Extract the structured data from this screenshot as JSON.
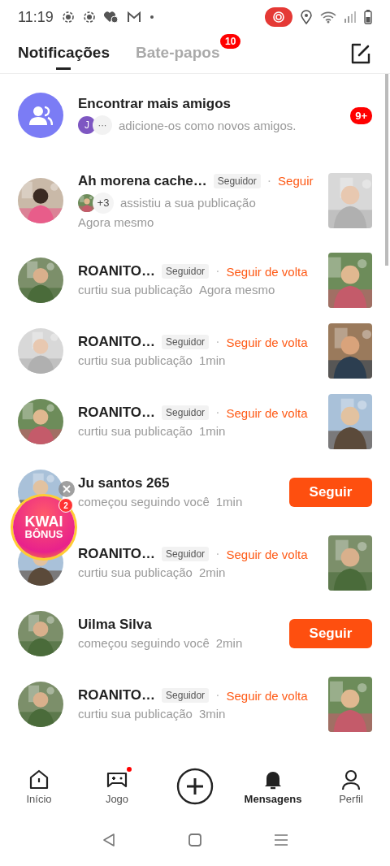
{
  "status_bar": {
    "time": "11:19"
  },
  "tabs": [
    {
      "label": "Notificações",
      "selected": true
    },
    {
      "label": "Bate-papos",
      "selected": false,
      "badge": "10"
    }
  ],
  "find_friends": {
    "title": "Encontrar mais amigos",
    "initial": "J",
    "more": "···",
    "text": "adicione-os como novos amigos.",
    "badge": "9+"
  },
  "notifications": [
    {
      "kind": "activity",
      "name": "Ah morena cache…",
      "tag": "Seguidor",
      "separator": "·",
      "action": "Seguir",
      "extra": "+3",
      "text": "assistiu a sua publicação",
      "time": "Agora mesmo"
    },
    {
      "kind": "activity",
      "name": "ROANITO…",
      "tag": "Seguidor",
      "separator": "·",
      "action": "Seguir de volta",
      "text": "curtiu sua publicação",
      "time": "Agora mesmo"
    },
    {
      "kind": "activity",
      "name": "ROANITO…",
      "tag": "Seguidor",
      "separator": "·",
      "action": "Seguir de volta",
      "text": "curtiu sua publicação",
      "time": "1min"
    },
    {
      "kind": "activity",
      "name": "ROANITO…",
      "tag": "Seguidor",
      "separator": "·",
      "action": "Seguir de volta",
      "text": "curtiu sua publicação",
      "time": "1min"
    },
    {
      "kind": "follow",
      "name": "Ju santos 265",
      "text": "começou seguindo você",
      "time": "1min",
      "button": "Seguir"
    },
    {
      "kind": "activity",
      "name": "ROANITO…",
      "tag": "Seguidor",
      "separator": "·",
      "action": "Seguir de volta",
      "text": "curtiu sua publicação",
      "time": "2min"
    },
    {
      "kind": "follow",
      "name": "Uilma Silva",
      "text": "começou seguindo você",
      "time": "2min",
      "button": "Seguir"
    },
    {
      "kind": "activity",
      "name": "ROANITO…",
      "tag": "Seguidor",
      "separator": "·",
      "action": "Seguir de volta",
      "text": "curtiu sua publicação",
      "time": "3min"
    }
  ],
  "bonus": {
    "title": "KWAI",
    "subtitle": "BÔNUS",
    "badge": "2"
  },
  "nav": [
    {
      "kind": "tab",
      "label": "Início",
      "selected": false,
      "dot": false
    },
    {
      "kind": "tab",
      "label": "Jogo",
      "selected": false,
      "dot": true
    },
    {
      "kind": "create"
    },
    {
      "kind": "tab",
      "label": "Mensagens",
      "selected": true,
      "dot": false
    },
    {
      "kind": "tab",
      "label": "Perfil",
      "selected": false,
      "dot": false
    }
  ]
}
